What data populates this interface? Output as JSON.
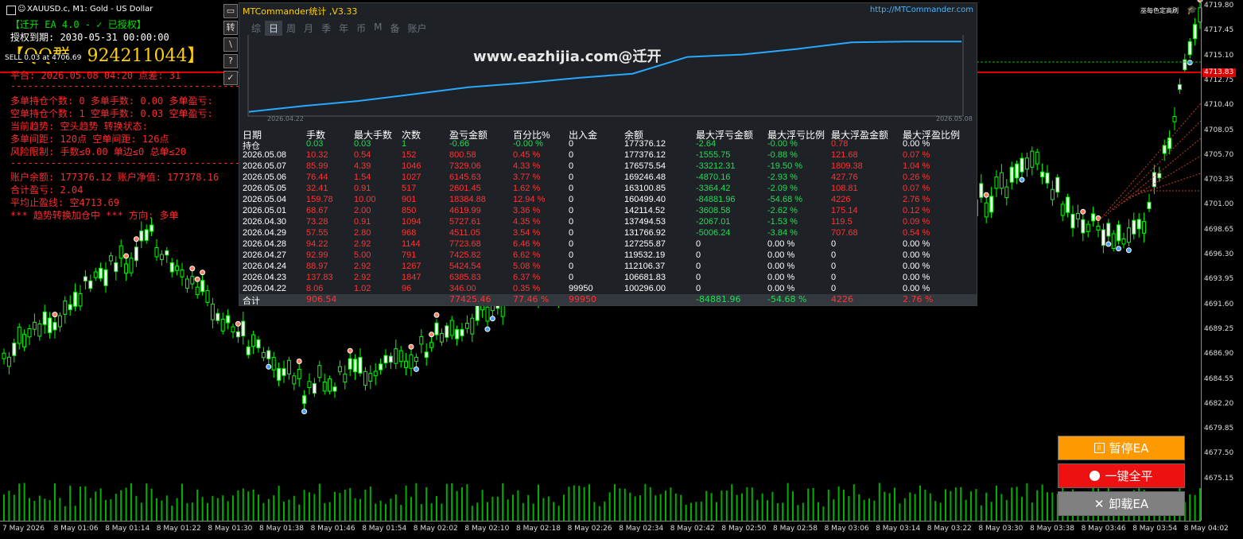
{
  "chart": {
    "symbol_title": "XAUUSD.c, M1:  Gold - US Dollar",
    "price_labels": [
      "4719.80",
      "4717.45",
      "4715.10",
      "4712.75",
      "4710.40",
      "4708.05",
      "4705.70",
      "4703.35",
      "4701.00",
      "4698.65",
      "4696.30",
      "4693.95",
      "4691.60",
      "4689.25",
      "4686.90",
      "4684.55",
      "4682.20",
      "4679.85",
      "4677.50",
      "4675.15"
    ],
    "current_price": "4713.83",
    "time_labels": [
      "7 May 2026",
      "8 May 01:06",
      "8 May 01:14",
      "8 May 01:22",
      "8 May 01:30",
      "8 May 01:38",
      "8 May 01:46",
      "8 May 01:54",
      "8 May 02:02",
      "8 May 02:10",
      "8 May 02:18",
      "8 May 02:26",
      "8 May 02:34",
      "8 May 02:42",
      "8 May 02:50",
      "8 May 02:58",
      "8 May 03:06",
      "8 May 03:14",
      "8 May 03:22",
      "8 May 03:30",
      "8 May 03:38",
      "8 May 03:46",
      "8 May 03:54",
      "8 May 04:02"
    ],
    "corner_text": "巫每色定高刷",
    "colors": {
      "bull": "#00ff00",
      "bear": "#ffffff",
      "price_line": "#e00000",
      "bid_line": "#00c000",
      "volume": "#00b000"
    }
  },
  "ea": {
    "title": "【迁开 EA 4.0 - ✓ 已授权】",
    "auth": "授权到期: 2030-05-31 00:00:00",
    "qq": "【QQ群 - 924211044】",
    "sell_tag": "SELL 0.03 at 4706.69",
    "lines": [
      "平台: 2026.05.08 04:20      点差: 31",
      "-----------------------------------------",
      "多单持仓个数: 0  多单手数: 0.00  多单盈亏:",
      "空单持仓个数: 1  空单手数: 0.03  空单盈亏:",
      "当前趋势: 空头趋势  转换状态:",
      "多单间距: 120点  空单间距: 126点",
      "风险限制: 手数≤0.00 单边≤0 总单≤20",
      "-----------------------------------------",
      "账户余额: 177376.12  账户净值: 177378.16",
      "合计盈亏: 2.04",
      "平均止盈线: 空4713.69",
      "*** 趋势转换加仓中 *** 方向: 多单"
    ]
  },
  "toolbar": {
    "icons": [
      "转",
      "\\",
      "?",
      "✓"
    ]
  },
  "panel": {
    "title": "MTCommander统计 ,V3.33",
    "url": "http://MTCommander.com",
    "tabs": [
      "综",
      "日",
      "周",
      "月",
      "季",
      "年",
      "币",
      "M",
      "备",
      "账户"
    ],
    "active_tab": "日",
    "watermark": "www.eazhijia.com@迁开",
    "equity_start_date": "2026.04.22",
    "equity_end_date": "2026.05.08",
    "equity_balances": [
      100296.0,
      106681.83,
      112106.37,
      119532.19,
      127255.87,
      131766.92,
      137494.53,
      142114.52,
      160499.4,
      163100.85,
      169246.48,
      176575.54,
      177376.12,
      177376.12
    ],
    "columns": [
      "日期",
      "手数",
      "最大手数",
      "次数",
      "盈亏金额",
      "百分比%",
      "出入金",
      "余额",
      "最大浮亏金额",
      "最大浮亏比例",
      "最大浮盈金额",
      "最大浮盈比例"
    ],
    "rows": [
      [
        "持仓",
        "0.03",
        "0.03",
        "1",
        "-0.66",
        "-0.00 %",
        "0",
        "177376.12",
        "-2.64",
        "-0.00 %",
        "0.78",
        "0.00 %"
      ],
      [
        "2026.05.08",
        "10.32",
        "0.54",
        "152",
        "800.58",
        "0.45 %",
        "0",
        "177376.12",
        "-1555.75",
        "-0.88 %",
        "121.68",
        "0.07 %"
      ],
      [
        "2026.05.07",
        "85.99",
        "4.39",
        "1046",
        "7329.06",
        "4.33 %",
        "0",
        "176575.54",
        "-33212.31",
        "-19.50 %",
        "1809.38",
        "1.04 %"
      ],
      [
        "2026.05.06",
        "76.44",
        "1.54",
        "1027",
        "6145.63",
        "3.77 %",
        "0",
        "169246.48",
        "-4870.16",
        "-2.93 %",
        "427.76",
        "0.26 %"
      ],
      [
        "2026.05.05",
        "32.41",
        "0.91",
        "517",
        "2601.45",
        "1.62 %",
        "0",
        "163100.85",
        "-3364.42",
        "-2.09 %",
        "108.81",
        "0.07 %"
      ],
      [
        "2026.05.04",
        "159.78",
        "10.00",
        "901",
        "18384.88",
        "12.94 %",
        "0",
        "160499.40",
        "-84881.96",
        "-54.68 %",
        "4226",
        "2.76 %"
      ],
      [
        "2026.05.01",
        "68.67",
        "2.00",
        "850",
        "4619.99",
        "3.36 %",
        "0",
        "142114.52",
        "-3608.58",
        "-2.62 %",
        "175.14",
        "0.12 %"
      ],
      [
        "2026.04.30",
        "73.28",
        "0.91",
        "1094",
        "5727.61",
        "4.35 %",
        "0",
        "137494.53",
        "-2067.01",
        "-1.53 %",
        "119.5",
        "0.09 %"
      ],
      [
        "2026.04.29",
        "57.55",
        "2.80",
        "968",
        "4511.05",
        "3.54 %",
        "0",
        "131766.92",
        "-5006.24",
        "-3.84 %",
        "707.68",
        "0.54 %"
      ],
      [
        "2026.04.28",
        "94.22",
        "2.92",
        "1144",
        "7723.68",
        "6.46 %",
        "0",
        "127255.87",
        "0",
        "0.00 %",
        "0",
        "0.00 %"
      ],
      [
        "2026.04.27",
        "92.99",
        "5.00",
        "791",
        "7425.82",
        "6.62 %",
        "0",
        "119532.19",
        "0",
        "0.00 %",
        "0",
        "0.00 %"
      ],
      [
        "2026.04.24",
        "88.97",
        "2.92",
        "1267",
        "5424.54",
        "5.08 %",
        "0",
        "112106.37",
        "0",
        "0.00 %",
        "0",
        "0.00 %"
      ],
      [
        "2026.04.23",
        "137.83",
        "2.92",
        "1847",
        "6385.83",
        "6.37 %",
        "0",
        "106681.83",
        "0",
        "0.00 %",
        "0",
        "0.00 %"
      ],
      [
        "2026.04.22",
        "8.06",
        "1.02",
        "96",
        "346.00",
        "0.35 %",
        "99950",
        "100296.00",
        "0",
        "0.00 %",
        "0",
        "0.00 %"
      ]
    ],
    "total": [
      "合计",
      "906.54",
      "",
      "",
      "77425.46",
      "77.46 %",
      "99950",
      "",
      "-84881.96",
      "-54.68 %",
      "4226",
      "2.76 %"
    ]
  },
  "buttons": {
    "pause": "暂停EA",
    "close_all": "一键全平",
    "unload": "卸载EA",
    "colors": {
      "pause": "#ff9900",
      "close_all": "#ee1111",
      "unload": "#808080"
    }
  }
}
